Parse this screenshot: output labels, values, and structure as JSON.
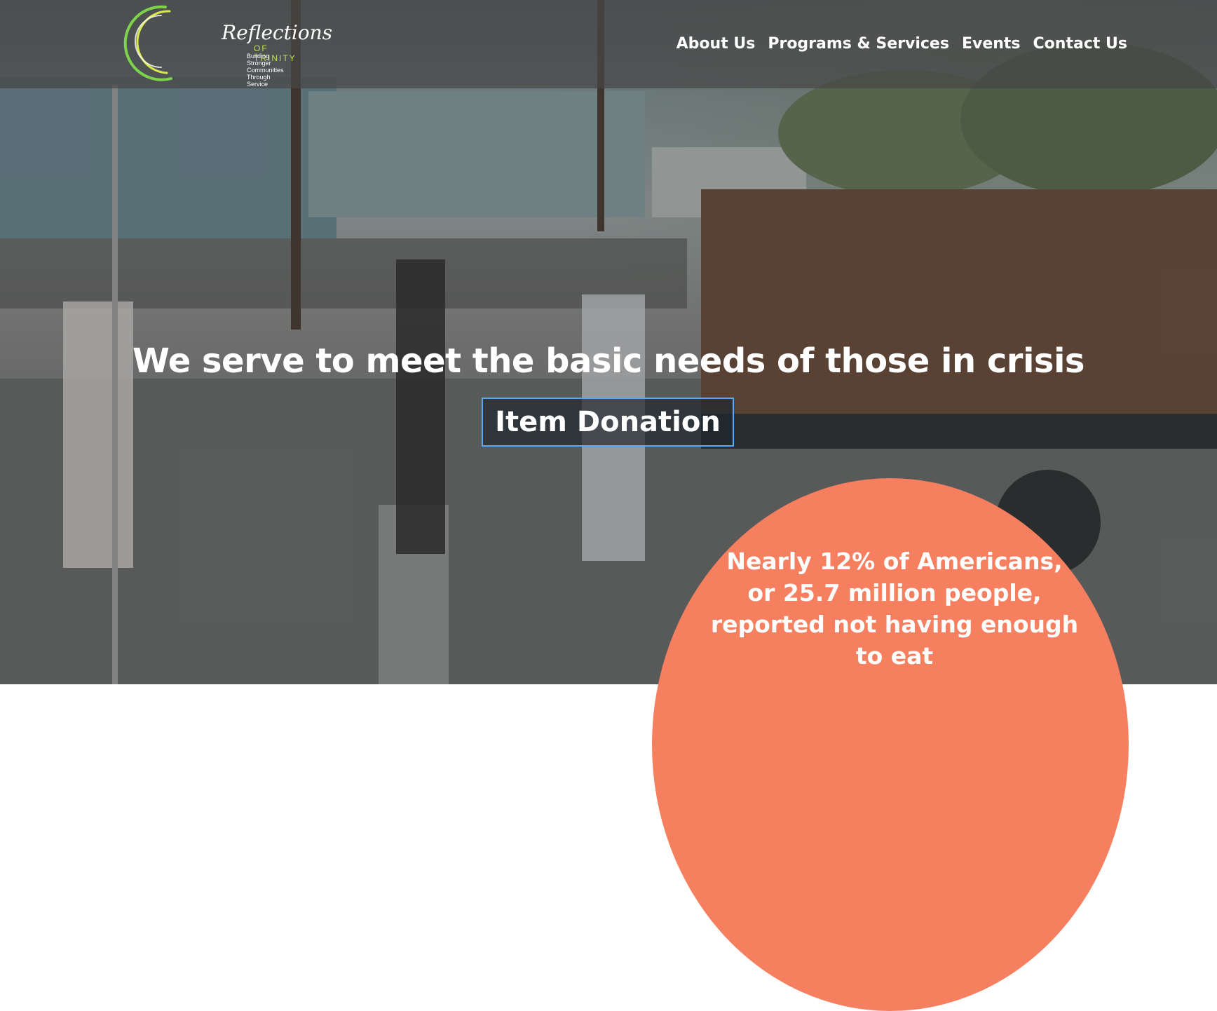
{
  "brand": {
    "title": "Reflections",
    "sub": "OF TRINITY",
    "tagline": "Building Stronger Communities Through Service",
    "colors": {
      "ring_green": "#7dd34a",
      "ring_lime": "#d9e84a",
      "accent": "#f57f5e"
    }
  },
  "nav": {
    "items": [
      {
        "label": "About Us"
      },
      {
        "label": "Programs & Services"
      },
      {
        "label": "Events"
      },
      {
        "label": "Contact Us"
      }
    ]
  },
  "hero": {
    "headline": "We serve to meet the basic needs of those in crisis",
    "cta_label": "Item Donation"
  },
  "stat": {
    "text_lines": [
      "Nearly 12% of Americans,",
      "or 25.7 million people,",
      "reported not having enough",
      "to eat"
    ]
  }
}
